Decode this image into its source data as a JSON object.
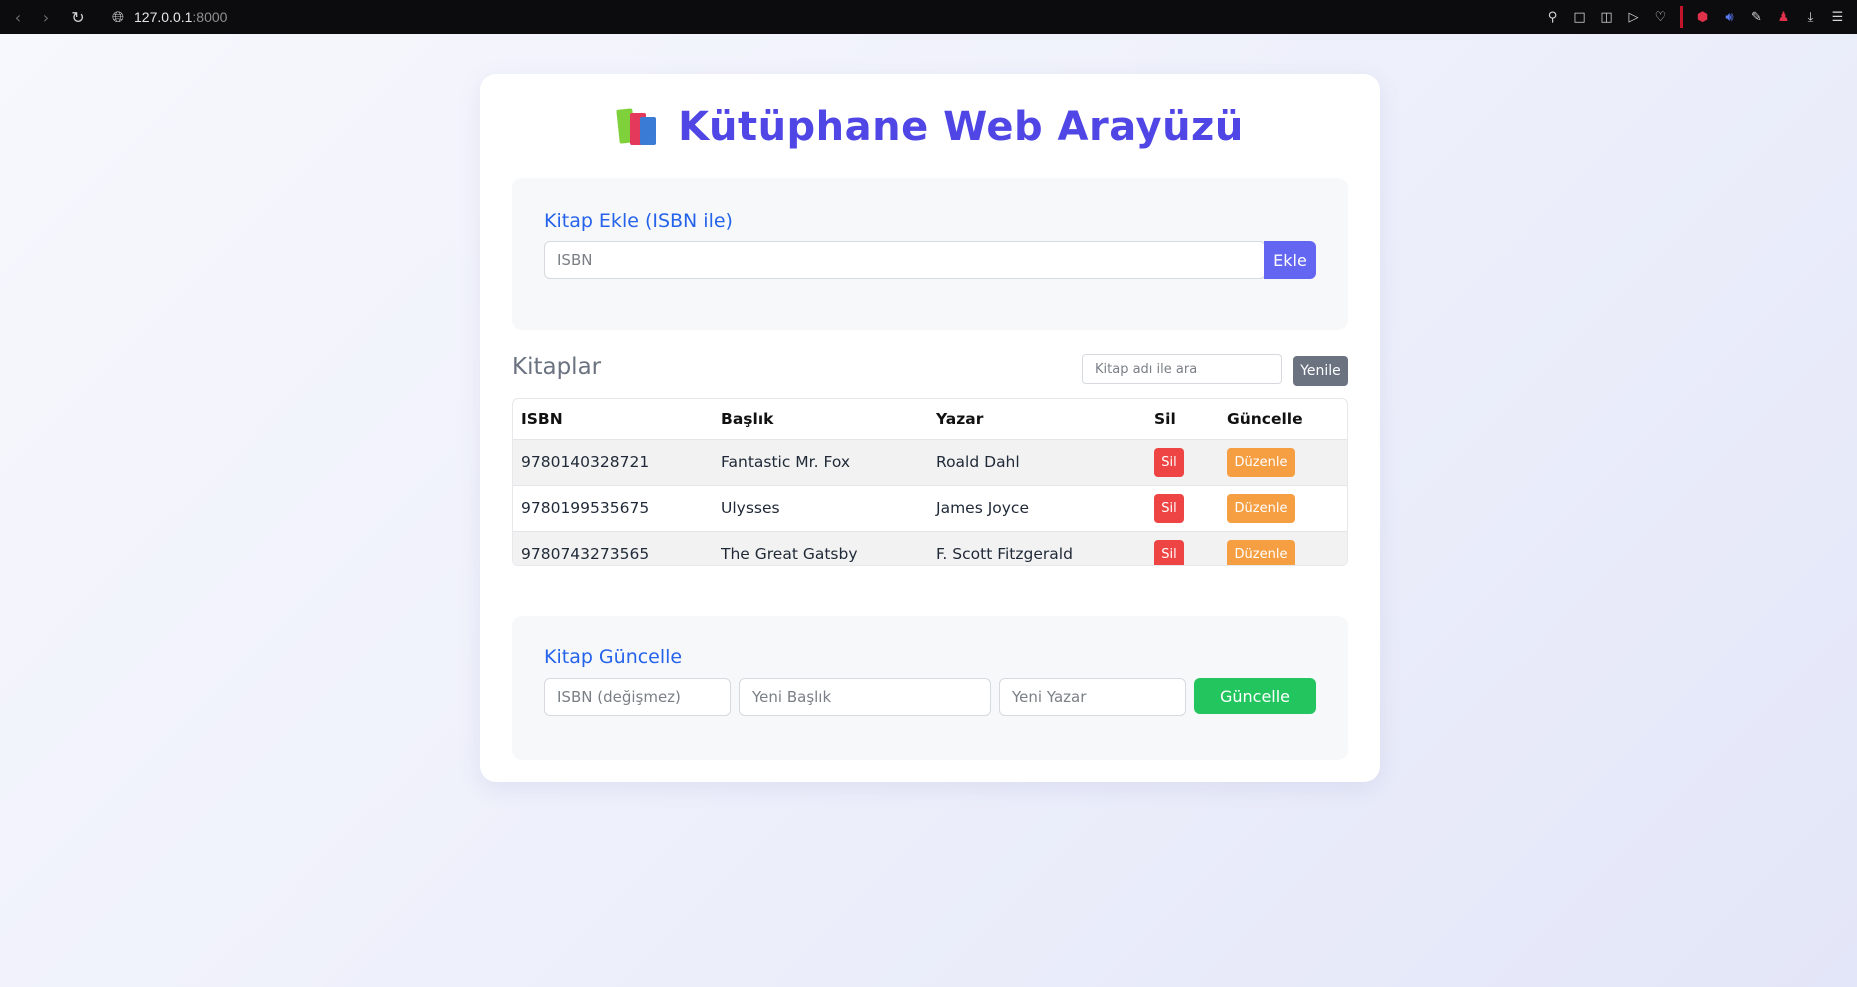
{
  "browser": {
    "url_host": "127.0.0.1",
    "url_port": ":8000"
  },
  "header": {
    "title": "Kütüphane Web Arayüzü",
    "icon": "books-icon"
  },
  "add_book": {
    "heading": "Kitap Ekle (ISBN ile)",
    "isbn_placeholder": "ISBN",
    "add_label": "Ekle"
  },
  "books": {
    "heading": "Kitaplar",
    "search_placeholder": "Kitap adı ile ara",
    "refresh_label": "Yenile",
    "columns": [
      "ISBN",
      "Başlık",
      "Yazar",
      "Sil",
      "Güncelle"
    ],
    "rows": [
      {
        "isbn": "9780140328721",
        "title": "Fantastic Mr. Fox",
        "author": "Roald Dahl",
        "delete": "Sil",
        "edit": "Düzenle"
      },
      {
        "isbn": "9780199535675",
        "title": "Ulysses",
        "author": "James Joyce",
        "delete": "Sil",
        "edit": "Düzenle"
      },
      {
        "isbn": "9780743273565",
        "title": "The Great Gatsby",
        "author": "F. Scott Fitzgerald",
        "delete": "Sil",
        "edit": "Düzenle"
      }
    ]
  },
  "update_book": {
    "heading": "Kitap Güncelle",
    "isbn_placeholder": "ISBN (değişmez)",
    "title_placeholder": "Yeni Başlık",
    "author_placeholder": "Yeni Yazar",
    "update_label": "Güncelle"
  },
  "colors": {
    "title": "#4f46e5",
    "heading": "#2563eb",
    "add_button": "#6366f1",
    "refresh_button": "#6b7280",
    "delete_button": "#ef4444",
    "edit_button": "#f59e42",
    "update_button": "#22c55e"
  }
}
